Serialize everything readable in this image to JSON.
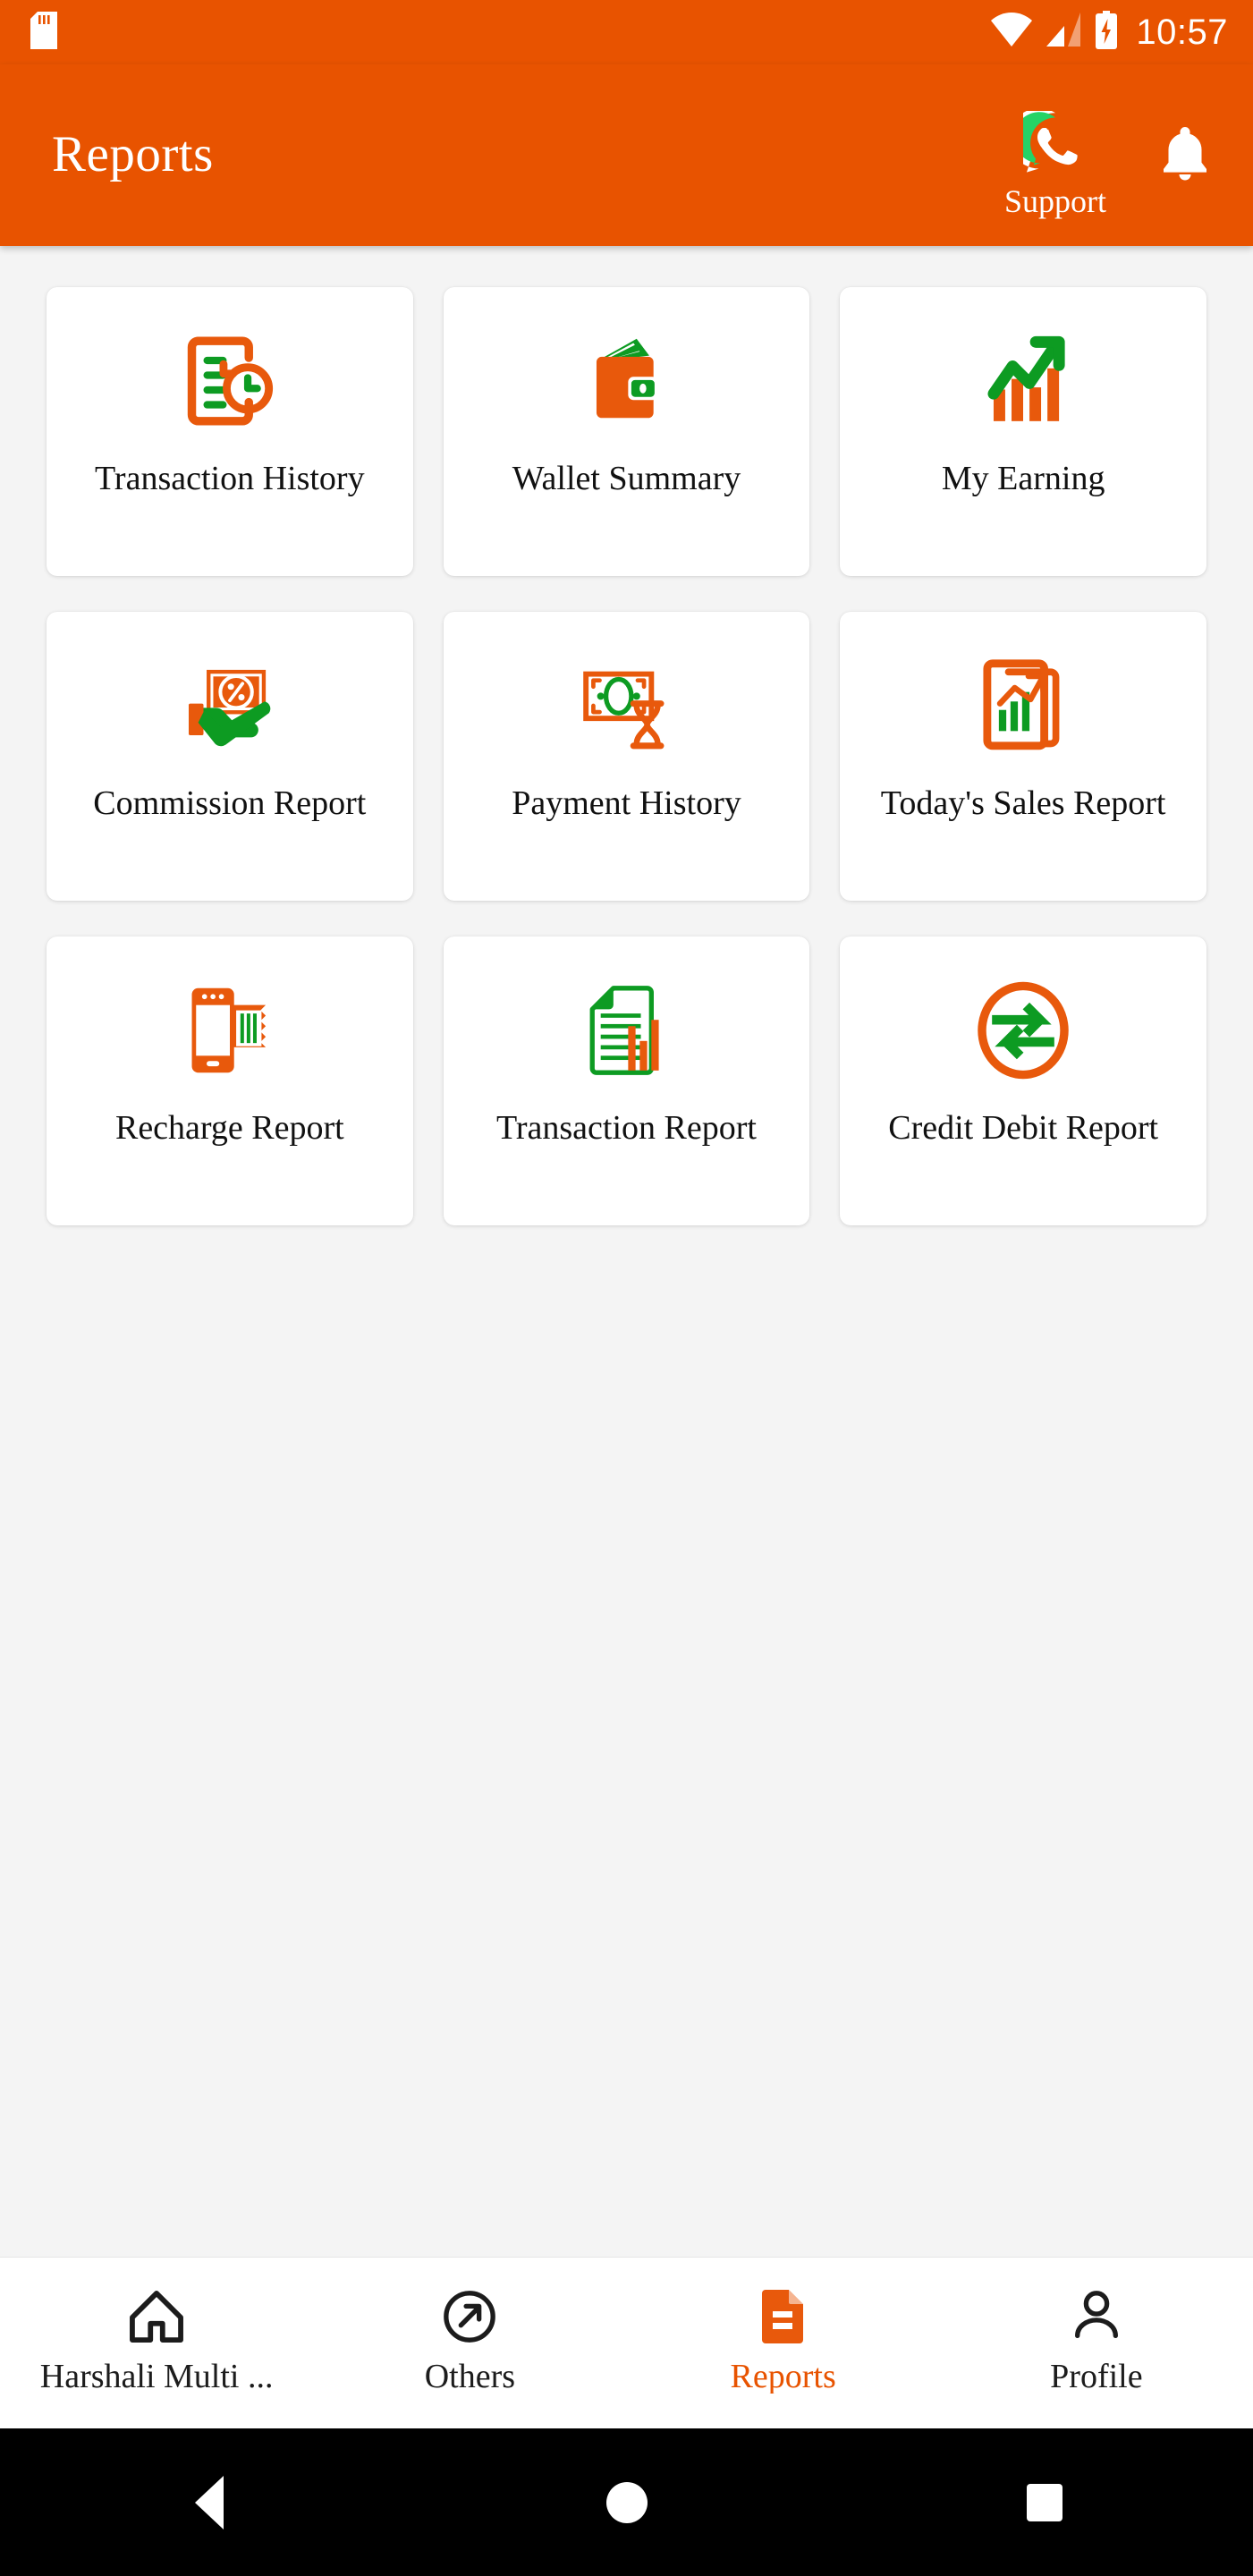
{
  "status_bar": {
    "time": "10:57",
    "icons": [
      "sd-card-icon",
      "wifi-icon",
      "cellular-signal-icon",
      "battery-charging-icon"
    ]
  },
  "app_bar": {
    "title": "Reports",
    "support_label": "Support",
    "support_icon": "whatsapp-icon",
    "notification_icon": "bell-icon",
    "background_color": "#e85300",
    "text_color": "#ffffff"
  },
  "theme": {
    "accent": "#e85300",
    "green": "#0d9b22",
    "page_background": "#f4f4f4",
    "card_background": "#ffffff"
  },
  "grid": {
    "tiles": [
      {
        "label": "Transaction History",
        "icon": "transaction-history-icon"
      },
      {
        "label": "Wallet Summary",
        "icon": "wallet-summary-icon"
      },
      {
        "label": "My Earning",
        "icon": "my-earning-icon"
      },
      {
        "label": "Commission Report",
        "icon": "commission-report-icon"
      },
      {
        "label": "Payment History",
        "icon": "payment-history-icon"
      },
      {
        "label": "Today's Sales Report",
        "icon": "todays-sales-report-icon"
      },
      {
        "label": "Recharge Report",
        "icon": "recharge-report-icon"
      },
      {
        "label": "Transaction Report",
        "icon": "transaction-report-icon"
      },
      {
        "label": "Credit Debit Report",
        "icon": "credit-debit-report-icon"
      }
    ]
  },
  "bottom_nav": {
    "items": [
      {
        "label": "Harshali Multi ...",
        "icon": "home-icon",
        "active": false
      },
      {
        "label": "Others",
        "icon": "arrow-circle-icon",
        "active": false
      },
      {
        "label": "Reports",
        "icon": "document-icon",
        "active": true
      },
      {
        "label": "Profile",
        "icon": "person-icon",
        "active": false
      }
    ]
  },
  "android_nav": {
    "buttons": [
      "back-button",
      "home-button",
      "recents-button"
    ]
  }
}
